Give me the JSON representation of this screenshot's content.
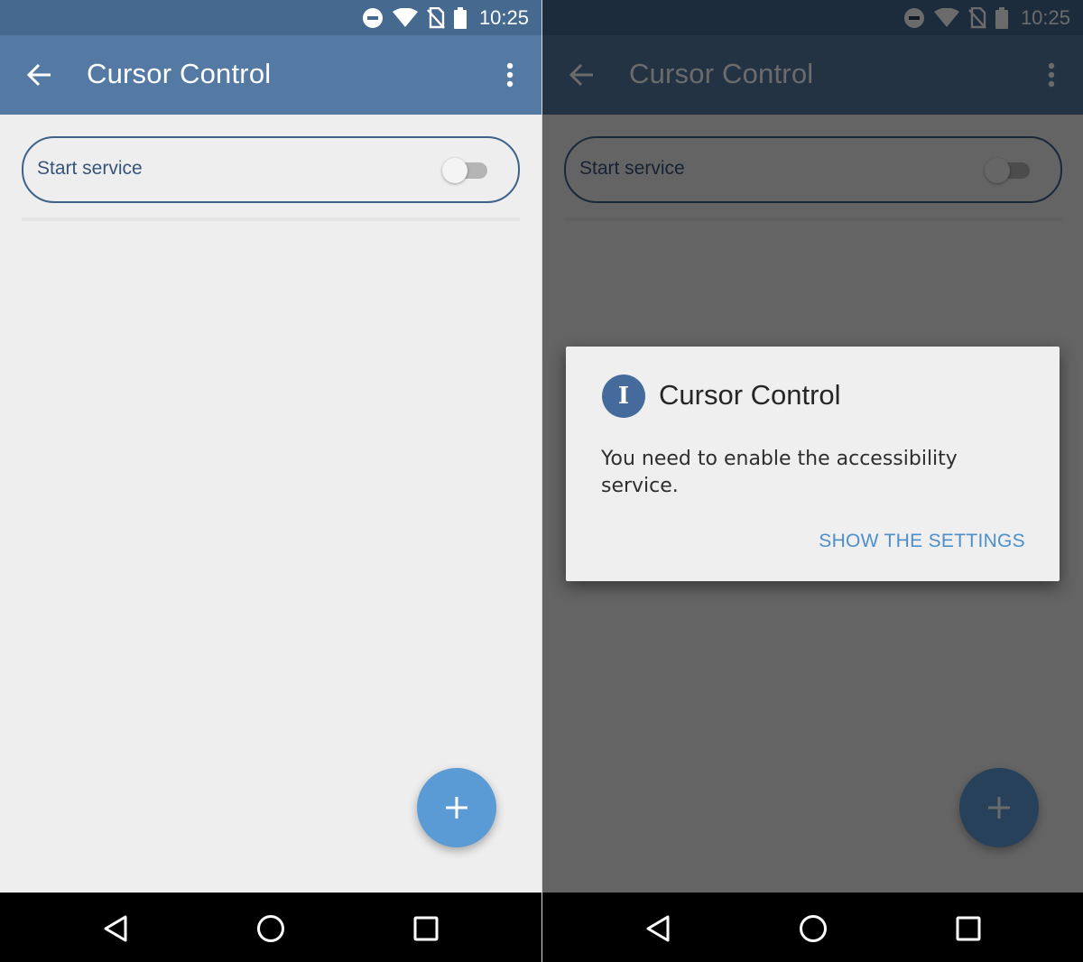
{
  "status_bar": {
    "time": "10:25",
    "icons": [
      "do-not-disturb-icon",
      "wifi-icon",
      "no-sim-icon",
      "battery-icon"
    ]
  },
  "app_bar": {
    "title": "Cursor Control",
    "back_icon": "arrow-left-icon",
    "menu_icon": "more-vert-icon"
  },
  "content": {
    "service_label": "Start service",
    "service_switch_on": false
  },
  "fab": {
    "icon": "plus-icon"
  },
  "nav_bar": {
    "icons": [
      "back-triangle-icon",
      "home-circle-icon",
      "recents-square-icon"
    ]
  },
  "dialog": {
    "title": "Cursor Control",
    "icon_glyph": "I",
    "message": "You need to enable the accessibility service.",
    "action": "SHOW THE SETTINGS"
  },
  "colors": {
    "status_bar": "#46698f",
    "app_bar": "#5479a3",
    "background": "#eeeeee",
    "fab": "#5b9bd5",
    "dialog_action": "#4e8fca",
    "card_border": "#3f6288"
  }
}
